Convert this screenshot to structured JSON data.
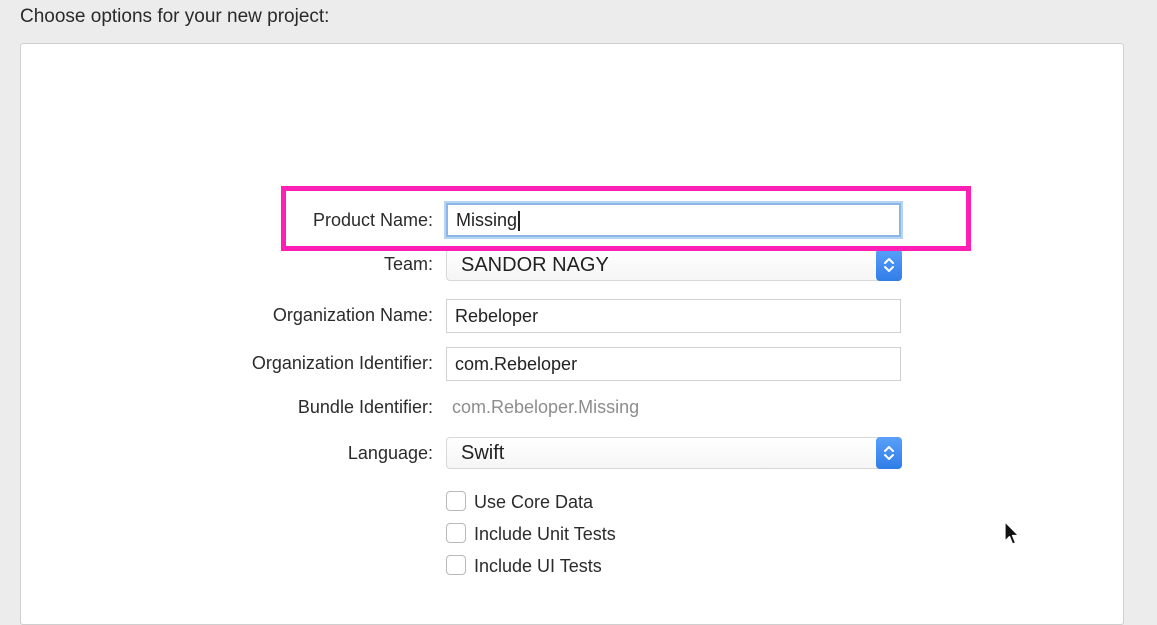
{
  "header": {
    "title": "Choose options for your new project:"
  },
  "form": {
    "product_name": {
      "label": "Product Name:",
      "value": "Missing"
    },
    "team": {
      "label": "Team:",
      "value": "SANDOR NAGY"
    },
    "organization_name": {
      "label": "Organization Name:",
      "value": "Rebeloper"
    },
    "organization_identifier": {
      "label": "Organization Identifier:",
      "value": "com.Rebeloper"
    },
    "bundle_identifier": {
      "label": "Bundle Identifier:",
      "value": "com.Rebeloper.Missing"
    },
    "language": {
      "label": "Language:",
      "value": "Swift"
    },
    "checkboxes": [
      {
        "label": "Use Core Data",
        "checked": false
      },
      {
        "label": "Include Unit Tests",
        "checked": false
      },
      {
        "label": "Include UI Tests",
        "checked": false
      }
    ]
  },
  "colors": {
    "highlight": "#ff1fb4",
    "focus_ring": "#8cb6e6",
    "popup_accent": "#2f7de8"
  },
  "icons": {
    "popup_stepper": "up-down-chevron-icon",
    "pointer": "mouse-pointer-icon"
  }
}
